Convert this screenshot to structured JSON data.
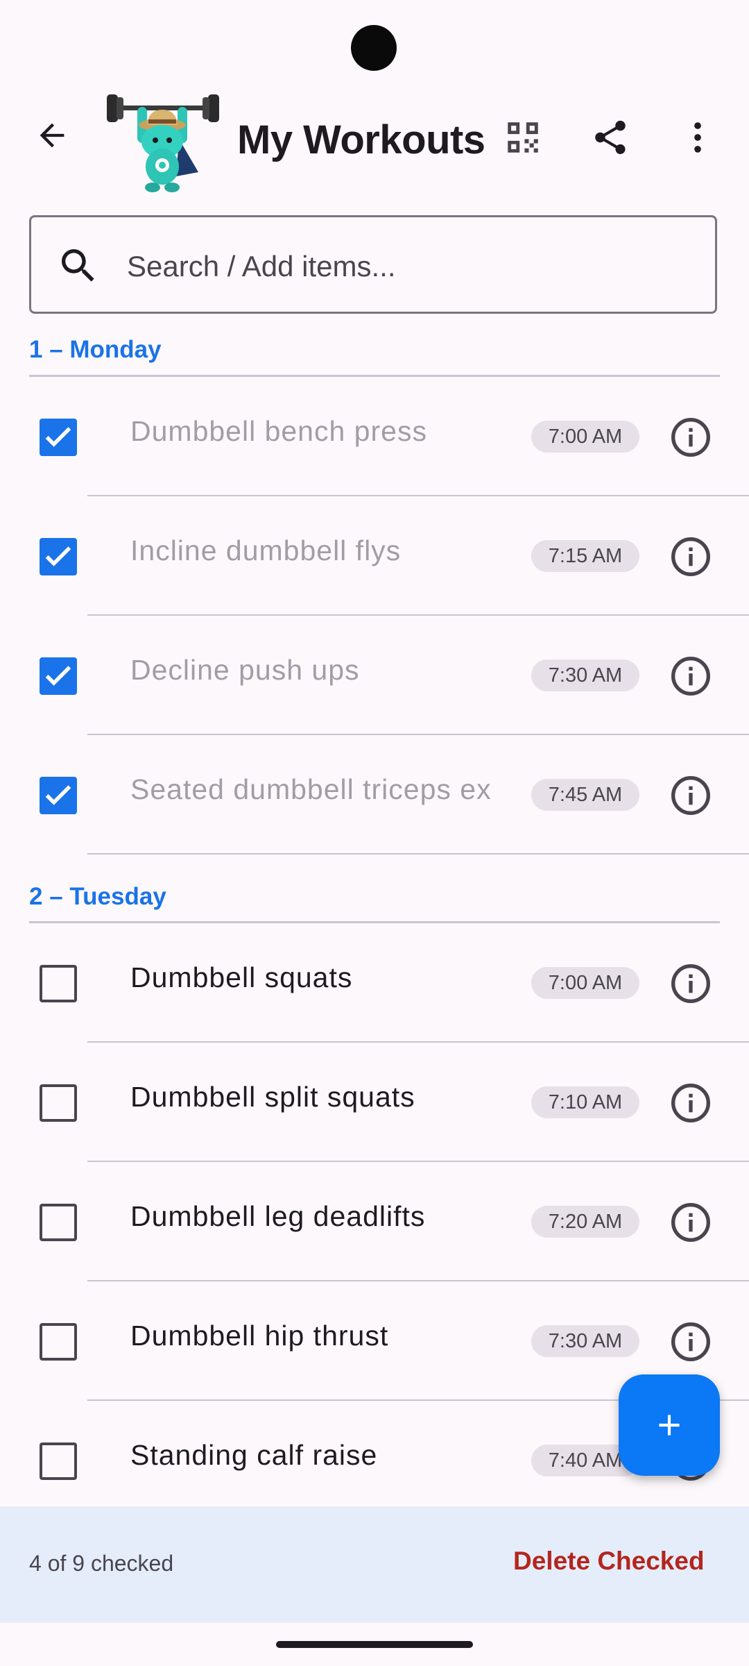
{
  "app_bar": {
    "title": "My Workouts"
  },
  "search": {
    "placeholder": "Search / Add items..."
  },
  "sections": [
    {
      "header": "1 – Monday",
      "items": [
        {
          "label": "Dumbbell bench press",
          "time": "7:00 AM",
          "checked": true
        },
        {
          "label": "Incline dumbbell flys",
          "time": "7:15 AM",
          "checked": true
        },
        {
          "label": "Decline push ups",
          "time": "7:30 AM",
          "checked": true
        },
        {
          "label": "Seated dumbbell triceps ex",
          "time": "7:45 AM",
          "checked": true
        }
      ]
    },
    {
      "header": "2 – Tuesday",
      "items": [
        {
          "label": "Dumbbell squats",
          "time": "7:00 AM",
          "checked": false
        },
        {
          "label": "Dumbbell split squats",
          "time": "7:10 AM",
          "checked": false
        },
        {
          "label": "Dumbbell leg deadlifts",
          "time": "7:20 AM",
          "checked": false
        },
        {
          "label": "Dumbbell hip thrust",
          "time": "7:30 AM",
          "checked": false
        },
        {
          "label": "Standing calf raise",
          "time": "7:40 AM",
          "checked": false
        }
      ]
    }
  ],
  "bottom_bar": {
    "count_text": "4 of 9 checked",
    "delete_label": "Delete Checked"
  },
  "colors": {
    "accent": "#1a73e8",
    "fab": "#0b78f5",
    "delete": "#b3261e",
    "bottom_bar_bg": "#e5edfa"
  },
  "icons": {
    "back": "arrow-left-icon",
    "qr": "qr-code-icon",
    "share": "share-icon",
    "more": "more-vert-icon",
    "search": "search-icon",
    "info": "info-icon",
    "add": "plus-icon"
  }
}
